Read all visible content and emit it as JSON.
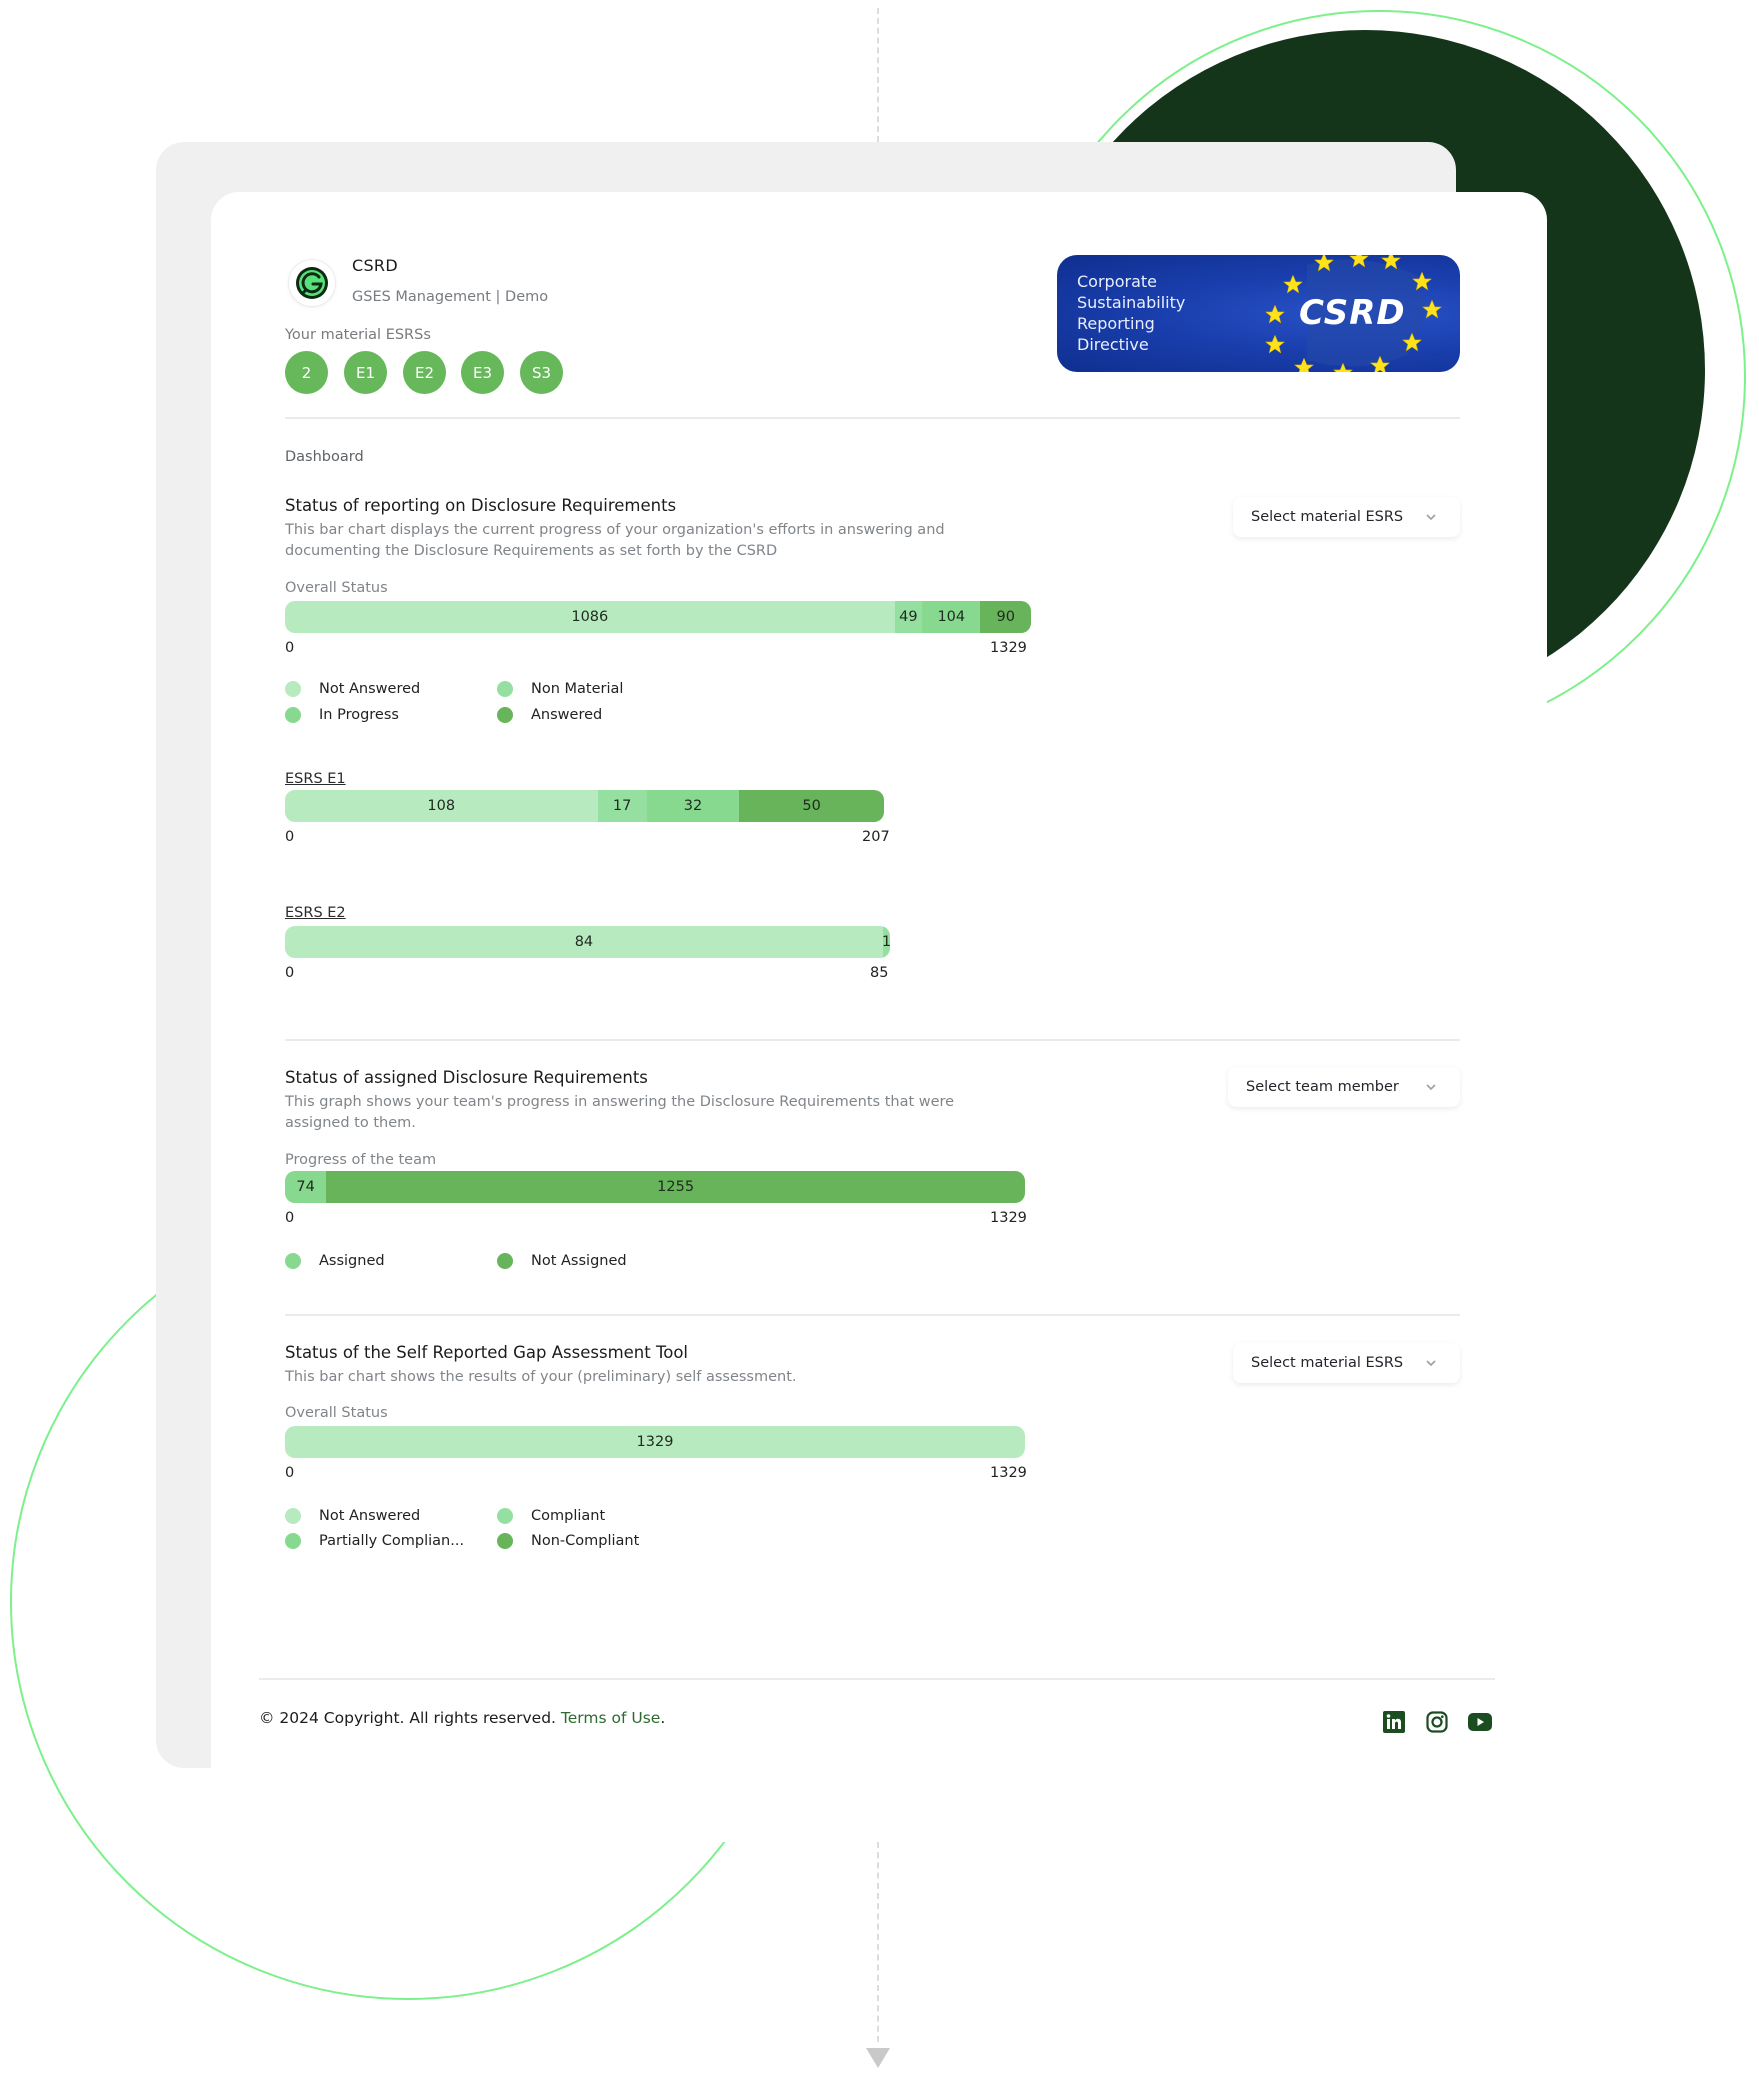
{
  "app": {
    "title": "CSRD",
    "subtitle": "GSES Management | Demo",
    "material_label": "Your material ESRSs",
    "material_esrs": [
      "2",
      "E1",
      "E2",
      "E3",
      "S3"
    ],
    "banner": {
      "lines": [
        "Corporate",
        "Sustainability",
        "Reporting",
        "Directive"
      ],
      "logo_text": "CSRD"
    }
  },
  "dashboard_label": "Dashboard",
  "colors": {
    "not_answered": "#b8eac0",
    "non_material": "#95e0a1",
    "in_progress": "#86d98e",
    "answered": "#68b45a",
    "esrs_chip": "#66b85a",
    "dark_disc": "#15351b",
    "ring": "#7cf08a",
    "footer_link": "#2d6a2f",
    "social_icon": "#1b4d20"
  },
  "sections": [
    {
      "title": "Status of reporting on Disclosure Requirements",
      "description_lines": [
        "This bar chart displays the current progress of your organization's efforts in answering and",
        "documenting the Disclosure Requirements as set forth by the CSRD"
      ],
      "dropdown": "Select material ESRS",
      "legend": [
        {
          "label": "Not Answered",
          "color": "#b8eac0"
        },
        {
          "label": "In Progress",
          "color": "#86d98e"
        },
        {
          "label": "Non Material",
          "color": "#95e0a1"
        },
        {
          "label": "Answered",
          "color": "#68b45a"
        }
      ]
    },
    {
      "title": "Status of assigned Disclosure Requirements",
      "description_lines": [
        "This graph shows your team's progress in answering the Disclosure Requirements that were",
        "assigned to them."
      ],
      "dropdown": "Select team member",
      "legend": [
        {
          "label": "Assigned",
          "color": "#86d98e"
        },
        {
          "label": "Not Assigned",
          "color": "#68b45a"
        }
      ]
    },
    {
      "title": "Status of the Self Reported Gap Assessment Tool",
      "description_lines": [
        "This bar chart shows the results of your (preliminary) self assessment."
      ],
      "dropdown": "Select material ESRS",
      "legend": [
        {
          "label": "Not Answered",
          "color": "#b8eac0"
        },
        {
          "label": "Partially Complian...",
          "color": "#86d98e"
        },
        {
          "label": "Compliant",
          "color": "#95e0a1"
        },
        {
          "label": "Non-Compliant",
          "color": "#68b45a"
        }
      ]
    }
  ],
  "chart_data": [
    {
      "type": "bar",
      "orientation": "horizontal-stacked",
      "title": "Overall Status",
      "categories": [
        "Not Answered",
        "Non Material",
        "In Progress",
        "Answered"
      ],
      "values": [
        1086,
        49,
        104,
        90
      ],
      "colors": [
        "#b8eac0",
        "#95e0a1",
        "#86d98e",
        "#68b45a"
      ],
      "xlim": [
        0,
        1329
      ],
      "tick_labels": [
        "0",
        "1329"
      ]
    },
    {
      "type": "bar",
      "orientation": "horizontal-stacked",
      "title": "ESRS E1",
      "categories": [
        "Not Answered",
        "Non Material",
        "In Progress",
        "Answered"
      ],
      "values": [
        108,
        17,
        32,
        50
      ],
      "colors": [
        "#b8eac0",
        "#95e0a1",
        "#86d98e",
        "#68b45a"
      ],
      "xlim": [
        0,
        207
      ],
      "tick_labels": [
        "0",
        "207"
      ]
    },
    {
      "type": "bar",
      "orientation": "horizontal-stacked",
      "title": "ESRS E2",
      "categories": [
        "Not Answered",
        "Non Material"
      ],
      "values": [
        84,
        1
      ],
      "colors": [
        "#b8eac0",
        "#95e0a1"
      ],
      "xlim": [
        0,
        85
      ],
      "tick_labels": [
        "0",
        "85"
      ]
    },
    {
      "type": "bar",
      "orientation": "horizontal-stacked",
      "title": "Progress of the team",
      "categories": [
        "Assigned",
        "Not Assigned"
      ],
      "values": [
        74,
        1255
      ],
      "colors": [
        "#86d98e",
        "#68b45a"
      ],
      "xlim": [
        0,
        1329
      ],
      "tick_labels": [
        "0",
        "1329"
      ]
    },
    {
      "type": "bar",
      "orientation": "horizontal-stacked",
      "title": "Overall Status",
      "categories": [
        "Not Answered"
      ],
      "values": [
        1329
      ],
      "colors": [
        "#b8eac0"
      ],
      "xlim": [
        0,
        1329
      ],
      "tick_labels": [
        "0",
        "1329"
      ]
    }
  ],
  "footer": {
    "copyright": "© 2024 Copyright. All rights reserved.",
    "terms": "Terms of Use",
    "terms_suffix": ".",
    "social": [
      "linkedin-icon",
      "instagram-icon",
      "youtube-icon"
    ]
  }
}
